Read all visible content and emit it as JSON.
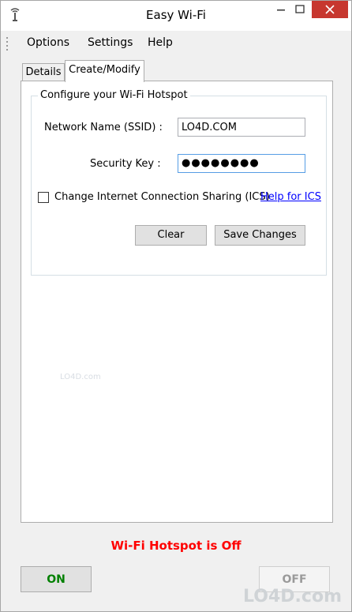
{
  "window": {
    "title": "Easy Wi-Fi"
  },
  "menu": {
    "items": [
      "Options",
      "Settings",
      "Help"
    ]
  },
  "tabs": [
    {
      "label": "Details"
    },
    {
      "label": "Create/Modify"
    }
  ],
  "group": {
    "title": "Configure your Wi-Fi Hotspot",
    "ssid_label": "Network Name (SSID) :",
    "ssid_value": "LO4D.COM",
    "key_label": "Security Key :",
    "key_value": "●●●●●●●●",
    "ics_label": "Change Internet Connection Sharing (ICS)",
    "ics_help": "Help for ICS",
    "clear_label": "Clear",
    "save_label": "Save Changes"
  },
  "status": {
    "text": "Wi-Fi Hotspot is Off",
    "color": "#ff0000"
  },
  "controls": {
    "on_label": "ON",
    "off_label": "OFF",
    "on_color": "#008000",
    "off_color": "#9a9a9a"
  },
  "watermark": {
    "text": "LO4D.com"
  }
}
